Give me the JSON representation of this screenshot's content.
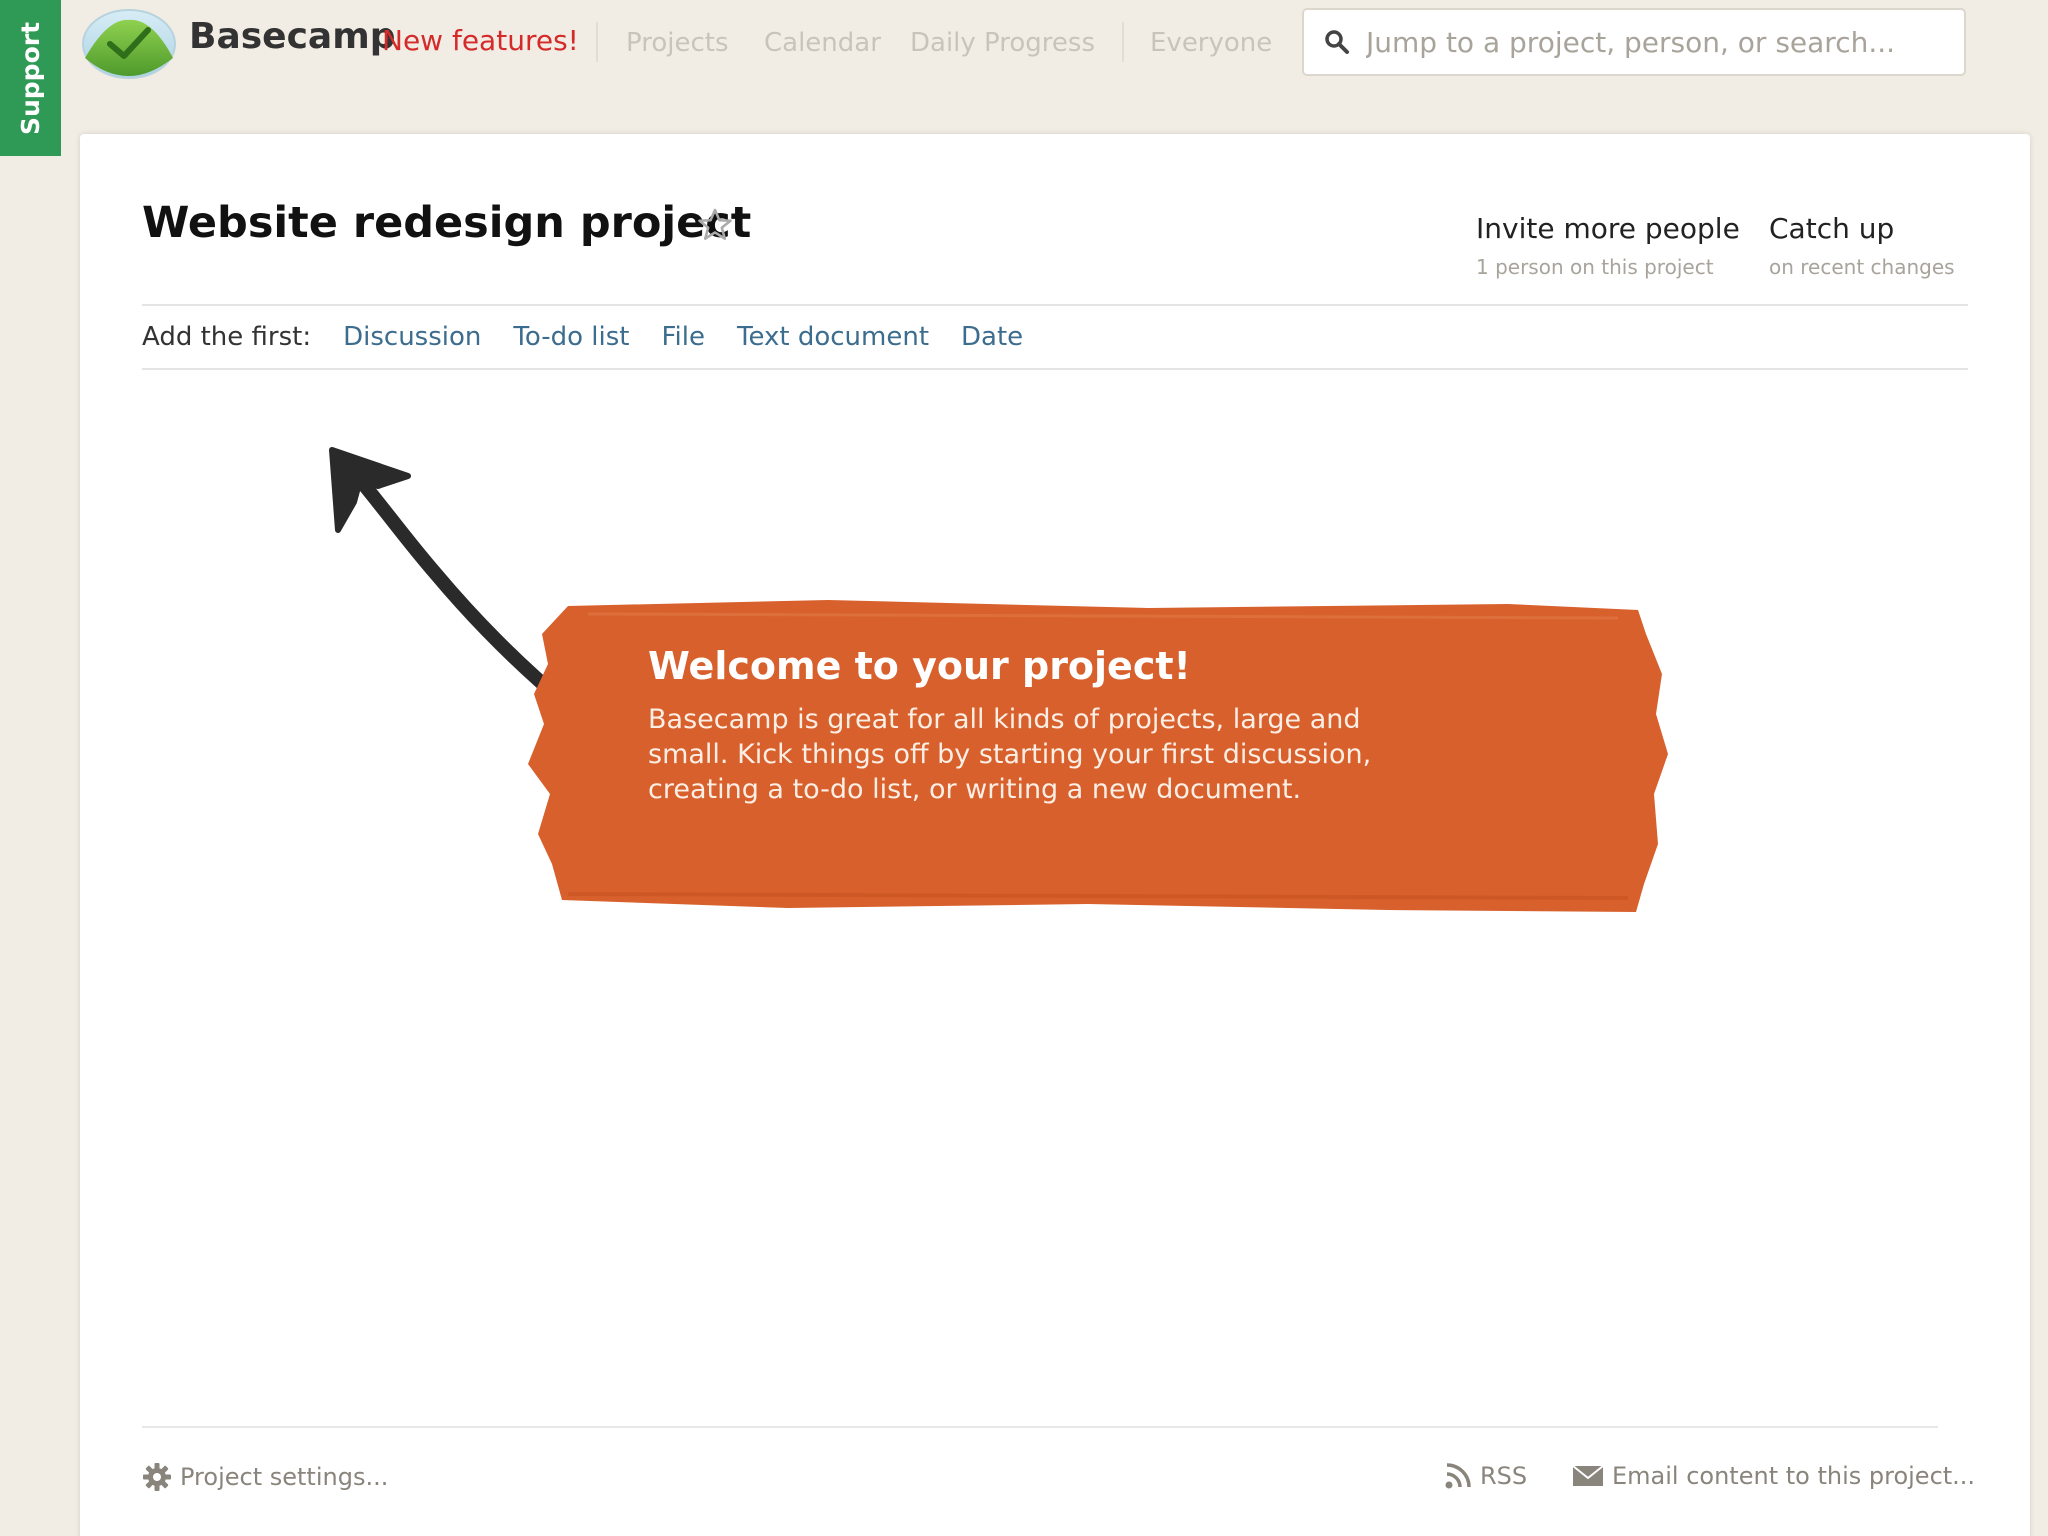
{
  "support": {
    "label": "Support"
  },
  "header": {
    "brand": "Basecamp",
    "new_features": "New features!",
    "nav": [
      "Projects",
      "Calendar",
      "Daily Progress",
      "Everyone"
    ],
    "search_placeholder": "Jump to a project, person, or search..."
  },
  "project": {
    "title": "Website redesign project",
    "invite": {
      "title": "Invite more people",
      "subtitle": "1 person on this project"
    },
    "catchup": {
      "title": "Catch up",
      "subtitle": "on recent changes"
    }
  },
  "add_first": {
    "label": "Add the first:",
    "links": [
      "Discussion",
      "To-do list",
      "File",
      "Text document",
      "Date"
    ]
  },
  "welcome": {
    "title": "Welcome to your project!",
    "body": "Basecamp is great for all kinds of projects, large and small. Kick things off by starting your first discussion, creating a to-do list, or writing a new document."
  },
  "footer": {
    "settings": "Project settings...",
    "rss": "RSS",
    "email": "Email content to this project..."
  },
  "colors": {
    "background": "#f1ede4",
    "support_green": "#2f9a55",
    "new_features_red": "#d52a2a",
    "link_blue": "#3d6d8e",
    "banner_orange": "#d8602c"
  }
}
